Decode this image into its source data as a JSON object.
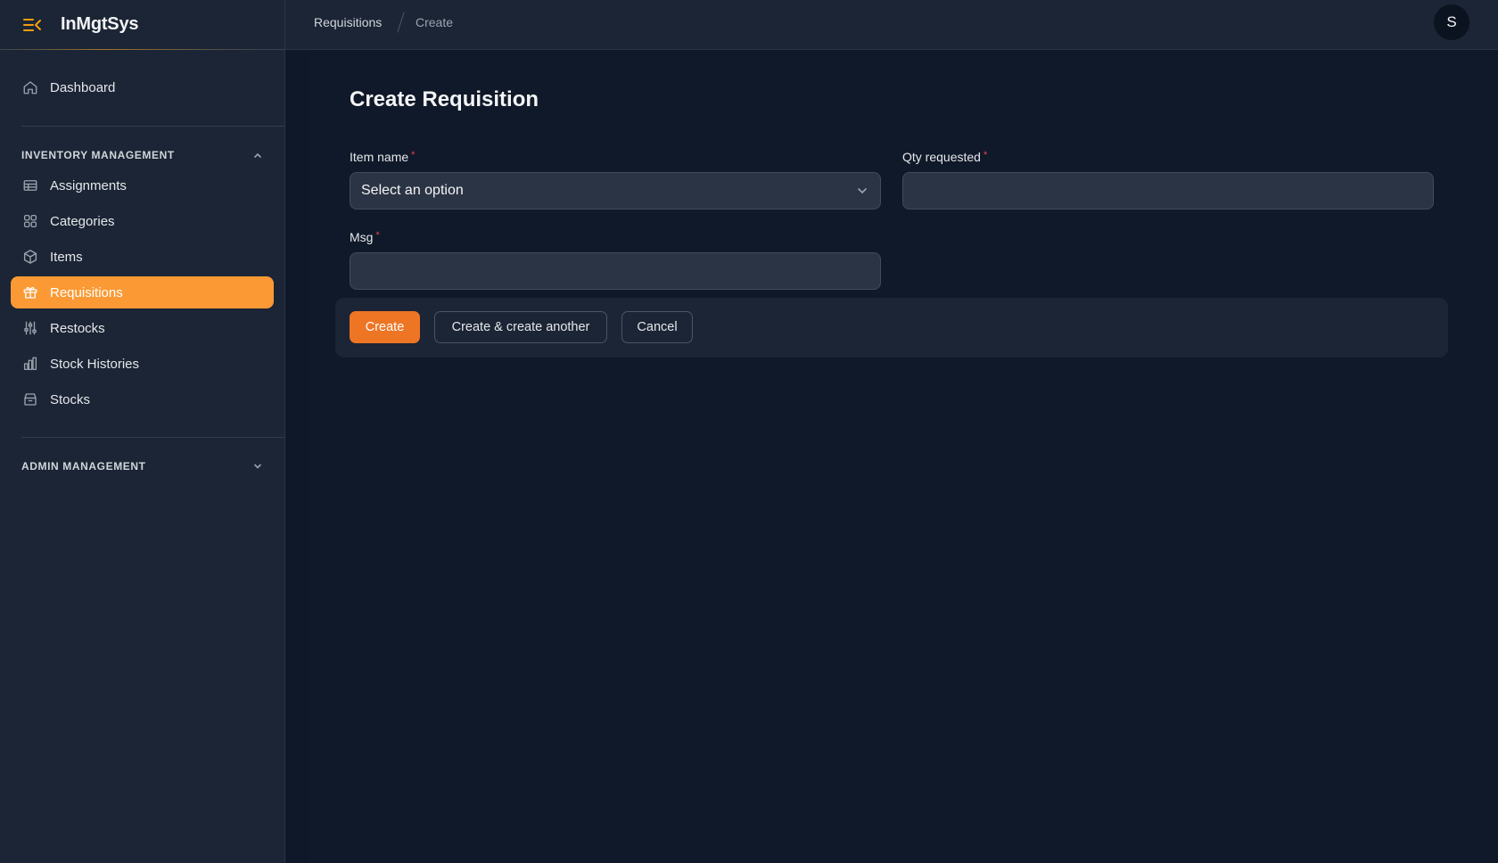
{
  "app": {
    "name": "InMgtSys"
  },
  "sidebar": {
    "top_items": [
      {
        "label": "Dashboard",
        "icon": "home-icon"
      }
    ],
    "inventory_group": {
      "title": "INVENTORY MANAGEMENT",
      "expanded": true,
      "items": [
        {
          "label": "Assignments",
          "icon": "table-icon"
        },
        {
          "label": "Categories",
          "icon": "grid-icon"
        },
        {
          "label": "Items",
          "icon": "cube-icon"
        },
        {
          "label": "Requisitions",
          "icon": "gift-icon",
          "active": true
        },
        {
          "label": "Restocks",
          "icon": "sliders-icon"
        },
        {
          "label": "Stock Histories",
          "icon": "bar-chart-icon"
        },
        {
          "label": "Stocks",
          "icon": "archive-icon"
        }
      ]
    },
    "admin_group": {
      "title": "ADMIN MANAGEMENT",
      "expanded": false
    }
  },
  "header": {
    "breadcrumb": [
      "Requisitions",
      "Create"
    ],
    "avatar_initial": "S"
  },
  "form": {
    "title": "Create Requisition",
    "fields": {
      "item_name": {
        "label": "Item name",
        "required_mark": "*",
        "value": "Select an option"
      },
      "qty_requested": {
        "label": "Qty requested",
        "required_mark": "*",
        "value": ""
      },
      "msg": {
        "label": "Msg",
        "required_mark": "*",
        "value": ""
      }
    },
    "buttons": {
      "create": "Create",
      "create_another": "Create & create another",
      "cancel": "Cancel"
    }
  },
  "colors": {
    "accent": "#fb9a35",
    "primary_button": "#ee7524",
    "background": "#0f1828",
    "sidebar": "#1b2535",
    "required": "#ef4444"
  }
}
